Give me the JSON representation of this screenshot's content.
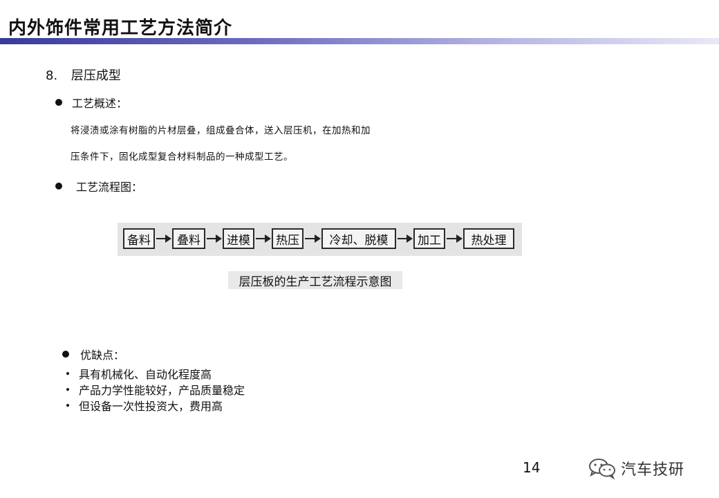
{
  "slide": {
    "title": "内外饰件常用工艺方法简介",
    "section_number": "8.",
    "section_title": "层压成型",
    "overview_label": "工艺概述：",
    "overview_text_line1": "将浸渍或涂有树脂的片材层叠，组成叠合体，送入层压机，在加热和加",
    "overview_text_line2": "压条件下，固化成型复合材料制品的一种成型工艺。",
    "flow_label": "工艺流程图：",
    "flow_steps": [
      "备料",
      "叠料",
      "进模",
      "热压",
      "冷却、脱模",
      "加工",
      "热处理"
    ],
    "flow_caption": "层压板的生产工艺流程示意图",
    "pros_cons_label": "优缺点：",
    "pros_cons_items": [
      "具有机械化、自动化程度高",
      "产品力学性能较好，产品质量稳定",
      "但设备一次性投资大，费用高"
    ],
    "page_number": "14",
    "watermark": "汽车技研"
  },
  "colors": {
    "title_bar_start": "#3a3a9a",
    "title_bar_end": "#e8e8f6",
    "flow_background": "#e4e4e4"
  }
}
